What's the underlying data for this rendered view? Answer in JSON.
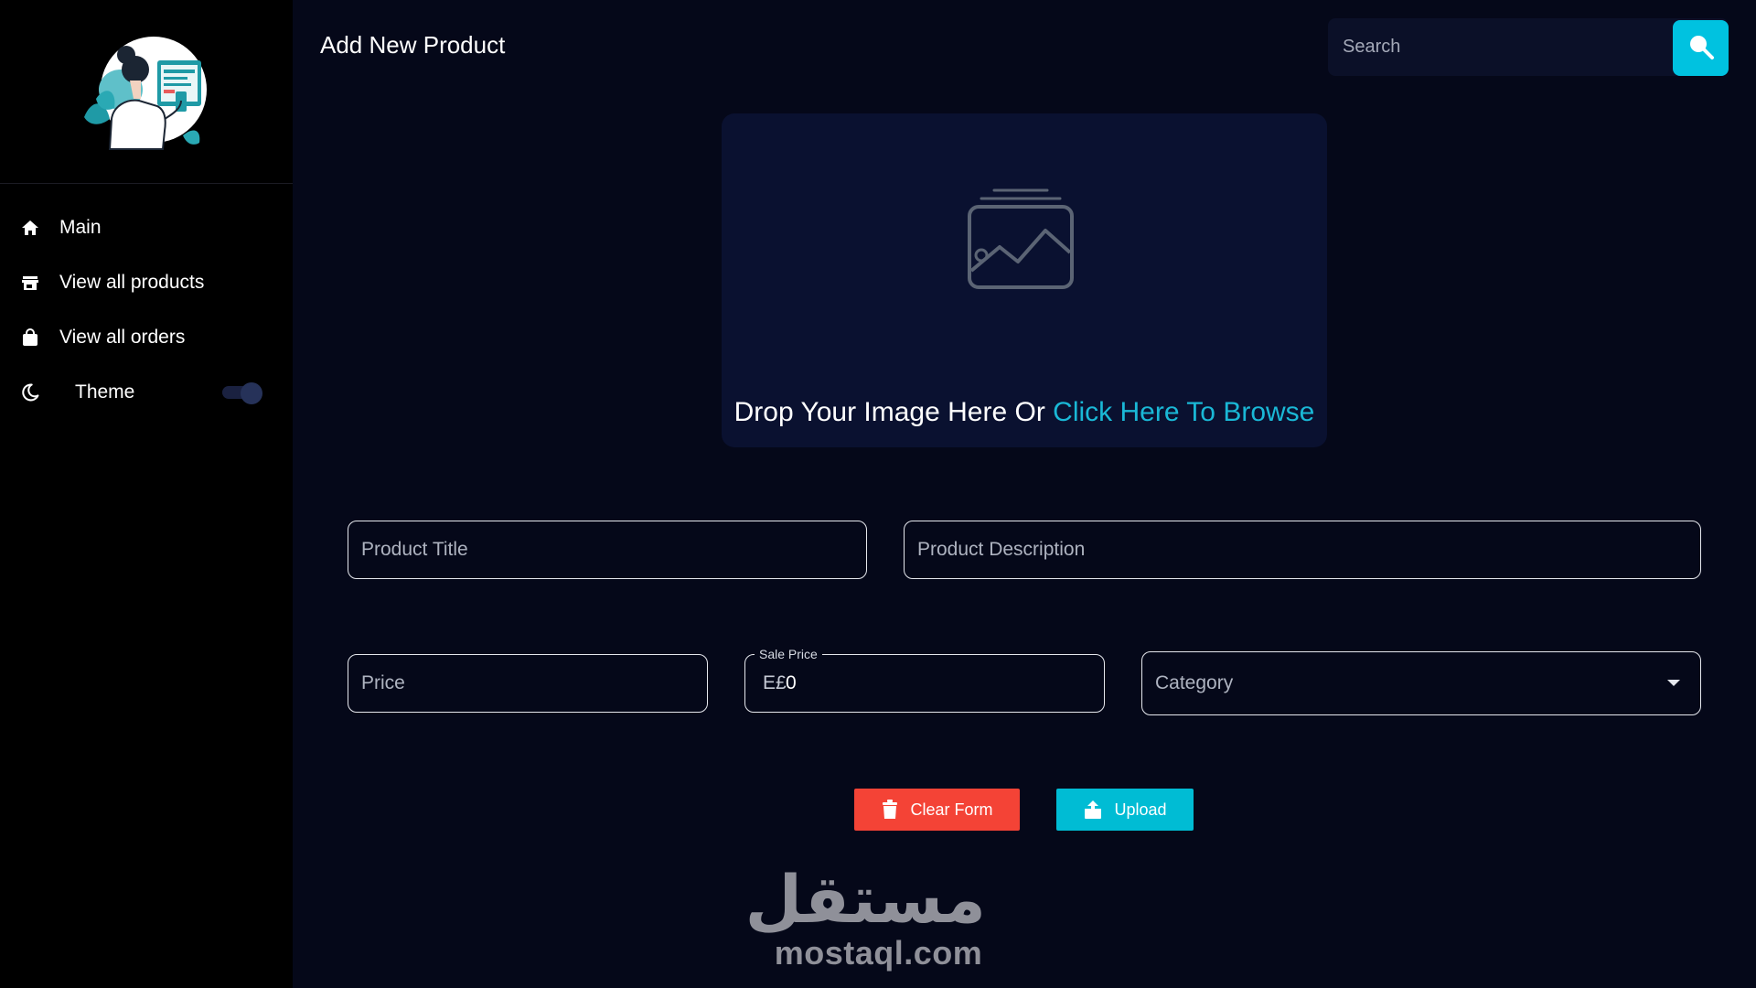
{
  "sidebar": {
    "logo_alt": "",
    "nav": [
      {
        "label": "Main",
        "icon": "home-icon"
      },
      {
        "label": "View all products",
        "icon": "store-icon"
      },
      {
        "label": "View all orders",
        "icon": "shopping-bag-icon"
      }
    ],
    "theme": {
      "label": "Theme",
      "icon": "moon-icon",
      "enabled": false
    }
  },
  "header": {
    "title": "Add New Product",
    "search": {
      "placeholder": "Search",
      "value": ""
    }
  },
  "upload": {
    "prompt": "Drop Your Image Here Or ",
    "browse_link": "Click Here To Browse",
    "icon": "image-placeholder-icon"
  },
  "form": {
    "title_placeholder": "Product Title",
    "description_placeholder": "Product Description",
    "price_placeholder": "Price",
    "sale_price": {
      "label": "Sale Price",
      "prefix": "E£",
      "value": "0"
    },
    "category": {
      "placeholder": "Category"
    }
  },
  "actions": {
    "clear_label": "Clear Form",
    "upload_label": "Upload"
  },
  "watermark": {
    "arabic": "مستقل",
    "latin": "mostaql.com"
  },
  "colors": {
    "background": "#050819",
    "sidebar": "#000000",
    "accent": "#00bcd4",
    "danger": "#f44336",
    "link": "#1ab8d6"
  }
}
